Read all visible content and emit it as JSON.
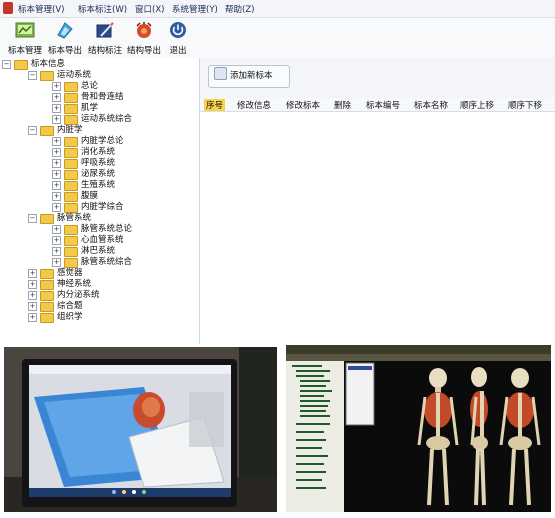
{
  "menu": [
    "标本管理(V)",
    "标本标注(W)",
    "窗口(X)",
    "系统管理(Y)",
    "帮助(Z)"
  ],
  "toolbar": [
    {
      "label": "标本管理",
      "icon": "specimen-manage-icon"
    },
    {
      "label": "标本导出",
      "icon": "specimen-export-icon"
    },
    {
      "label": "结构标注",
      "icon": "structure-annotate-icon"
    },
    {
      "label": "结构导出",
      "icon": "structure-export-icon"
    },
    {
      "label": "退出",
      "icon": "power-icon"
    }
  ],
  "tree": {
    "root": "标本信息",
    "groups": [
      {
        "label": "运动系统",
        "expanded": true,
        "children": [
          "总论",
          "骨和骨连结",
          "肌学",
          "运动系统综合"
        ]
      },
      {
        "label": "内脏学",
        "expanded": true,
        "children": [
          "内脏学总论",
          "消化系统",
          "呼吸系统",
          "泌尿系统",
          "生殖系统",
          "腹膜",
          "内脏学综合"
        ]
      },
      {
        "label": "脉管系统",
        "expanded": true,
        "children": [
          "脉管系统总论",
          "心血管系统",
          "淋巴系统",
          "脉管系统综合"
        ]
      },
      {
        "label": "感觉器",
        "expanded": false,
        "children": []
      },
      {
        "label": "神经系统",
        "expanded": false,
        "children": []
      },
      {
        "label": "内分泌系统",
        "expanded": false,
        "children": []
      },
      {
        "label": "综合题",
        "expanded": false,
        "children": []
      },
      {
        "label": "组织学",
        "expanded": false,
        "children": []
      }
    ]
  },
  "add_button": "添加新标本",
  "columns": [
    "序号",
    "修改信息",
    "修改标本",
    "删除",
    "标本编号",
    "标本名称",
    "顺序上移",
    "顺序下移"
  ],
  "colors": {
    "header_highlight": "#f7d24a",
    "accent": "#2b63c6",
    "menubar": "#f3f5f8"
  }
}
